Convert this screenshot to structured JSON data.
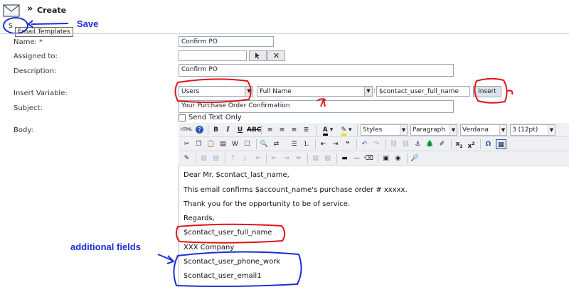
{
  "header": {
    "title": "Create",
    "tooltip": "Email Templates",
    "obscured_label": "S"
  },
  "annotations": {
    "save": "Save",
    "additional_fields": "additional fields"
  },
  "form": {
    "name": {
      "label": "Name: *",
      "value": "Confirm PO"
    },
    "assigned": {
      "label": "Assigned to:",
      "value": ""
    },
    "description": {
      "label": "Description:",
      "value": "Confirm PO"
    },
    "insert_variable": {
      "label": "Insert Variable:",
      "module": "Users",
      "field": "Full Name",
      "colon": ":",
      "variable": "$contact_user_full_name",
      "insert_button": "Insert"
    },
    "subject": {
      "label": "Subject:",
      "value": "Your Purchase Order Confirmation"
    },
    "send_text_only": {
      "label": "Send Text Only",
      "checked": false
    },
    "body": {
      "label": "Body:",
      "toolbar": {
        "styles": "Styles",
        "paragraph": "Paragraph",
        "font": "Verdana",
        "size": "3 (12pt)",
        "html_label": "HTML"
      },
      "lines": [
        "Dear Mr. $contact_last_name,",
        "This email confirms $account_name's purchase order # xxxxx.",
        "Thank you for the opportunity to be of service.",
        "Regards,",
        "$contact_user_full_name",
        "XXX Company",
        "$contact_user_phone_work",
        "$contact_user_email1"
      ]
    }
  },
  "colors": {
    "annotation_blue": "#1a2fd1",
    "annotation_red": "#e0141a"
  }
}
